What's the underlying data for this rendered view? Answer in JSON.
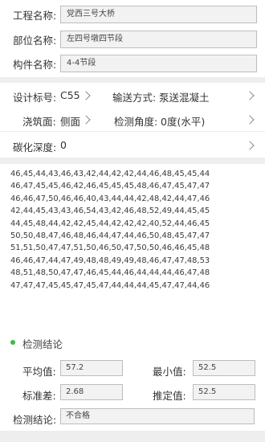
{
  "project": {
    "name_label": "工程名称:",
    "name_value": "党西三号大桥",
    "part_label": "部位名称:",
    "part_value": "左四号墩四节段",
    "component_label": "构件名称:",
    "component_value": "4-4节段"
  },
  "settings": {
    "design_grade_label": "设计标号:",
    "design_grade_value": "C55",
    "delivery_label": "输送方式:",
    "delivery_value": "泵送混凝土",
    "pour_face_label": "浇筑面:",
    "pour_face_value": "侧面",
    "angle_label": "检测角度:",
    "angle_value": "0度(水平)",
    "carbonation_label": "碳化深度:",
    "carbonation_value": "0"
  },
  "readings": [
    "46,45,44,43,46,43,42,44,42,42,44,46,48,45,45,44",
    "46,47,45,45,46,42,46,45,45,45,48,46,47,45,47,47",
    "46,46,47,50,46,46,40,43,44,44,42,48,42,44,47,46",
    "42,44,45,43,43,46,54,43,42,46,48,52,49,44,45,45",
    "44,45,48,44,42,42,45,44,42,42,42,40,52,44,46,45",
    "50,50,48,47,46,48,46,44,47,44,46,50,48,45,47,47",
    "51,51,50,47,47,51,50,46,50,47,50,50,46,46,45,48",
    "46,46,47,44,47,49,48,48,49,49,48,46,47,47,48,53",
    "48,51,48,50,47,47,46,45,44,46,44,44,44,46,47,48",
    "47,47,47,45,45,47,45,47,44,44,44,45,47,47,44,46"
  ],
  "conclusion": {
    "section_title": "检测结论",
    "avg_label": "平均值:",
    "avg_value": "57.2",
    "min_label": "最小值:",
    "min_value": "52.5",
    "std_label": "标准差:",
    "std_value": "2.68",
    "est_label": "推定值:",
    "est_value": "52.5",
    "result_label": "检测结论:",
    "result_value": "不合格"
  },
  "colors": {
    "accent": "#43b54b"
  }
}
